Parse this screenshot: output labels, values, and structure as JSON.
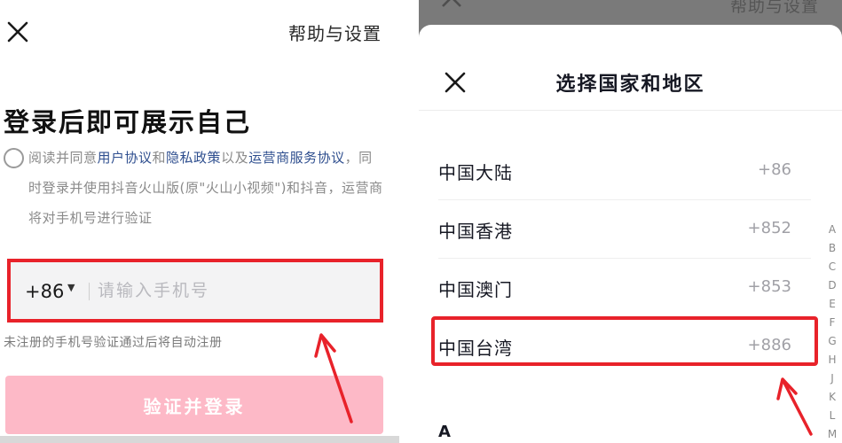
{
  "left": {
    "help_label": "帮助与设置",
    "title": "登录后即可展示自己",
    "agreement": {
      "p1": "阅读并同意",
      "user_agreement": "用户协议",
      "and": "和",
      "privacy_policy": "隐私政策",
      "also": "以及",
      "carrier_agreement": "运营商服务协议",
      "p2": "，同时登录并使用抖音火山版(原\"火山小视频\")和抖音，运营商将对手机号进行验证"
    },
    "country_code": "+86",
    "phone_placeholder": "请输入手机号",
    "auto_register_note": "未注册的手机号验证通过后将自动注册",
    "login_button": "验证并登录"
  },
  "right": {
    "bg_help_label": "帮助与设置",
    "sheet_title": "选择国家和地区",
    "regions": [
      {
        "name": "中国大陆",
        "code": "+86"
      },
      {
        "name": "中国香港",
        "code": "+852"
      },
      {
        "name": "中国澳门",
        "code": "+853"
      },
      {
        "name": "中国台湾",
        "code": "+886"
      }
    ],
    "section_header": "A",
    "index_letters": [
      "A",
      "B",
      "C",
      "D",
      "E",
      "F",
      "G",
      "H",
      "J",
      "K",
      "L",
      "M"
    ]
  },
  "colors": {
    "highlight": "#e8222a",
    "link": "#2f4f8f",
    "login_button": "#fdb9c7"
  },
  "icons": [
    "close-icon",
    "dropdown-caret-icon",
    "annotation-arrow-icon"
  ]
}
